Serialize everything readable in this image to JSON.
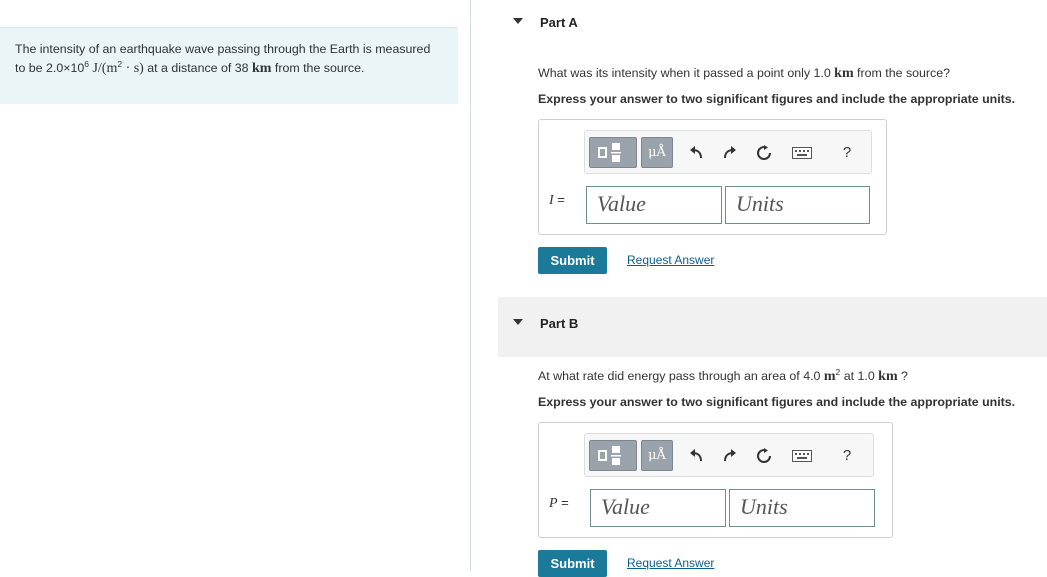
{
  "problem": {
    "prefix": "The intensity of an earthquake wave passing through the Earth is measured to be 2.0×10",
    "exponent": "6",
    "unit": "J/(m",
    "unit_exp": "2",
    "unit_tail": " · s)",
    "middle": " at a distance of 38 ",
    "distance_unit": "km",
    "suffix": " from the source."
  },
  "partA": {
    "title": "Part A",
    "question_prefix": "What was its intensity when it passed a point only 1.0 ",
    "question_unit": "km",
    "question_suffix": " from the source?",
    "instruction": "Express your answer to two significant figures and include the appropriate units.",
    "variable": "I",
    "equals": " =",
    "value_placeholder": "Value",
    "units_placeholder": "Units",
    "submit_label": "Submit",
    "request_label": "Request Answer"
  },
  "partB": {
    "title": "Part B",
    "question_prefix": "At what rate did energy pass through an area of 4.0 ",
    "question_area_unit": "m",
    "question_area_exp": "2",
    "question_middle": " at 1.0 ",
    "question_unit": "km",
    "question_suffix": " ?",
    "instruction": "Express your answer to two significant figures and include the appropriate units.",
    "variable": "P",
    "equals": " =",
    "value_placeholder": "Value",
    "units_placeholder": "Units",
    "submit_label": "Submit",
    "request_label": "Request Answer"
  },
  "toolbar": {
    "units_symbol": "μÅ",
    "help_symbol": "?",
    "icons": [
      "templates-icon",
      "units-icon",
      "undo-icon",
      "redo-icon",
      "reset-icon",
      "keyboard-icon",
      "help-icon"
    ]
  },
  "colors": {
    "problem_bg": "#e9f5f6",
    "band_bg": "#f1f1f1",
    "submit_bg": "#1b7a99",
    "link": "#0b5e92"
  }
}
